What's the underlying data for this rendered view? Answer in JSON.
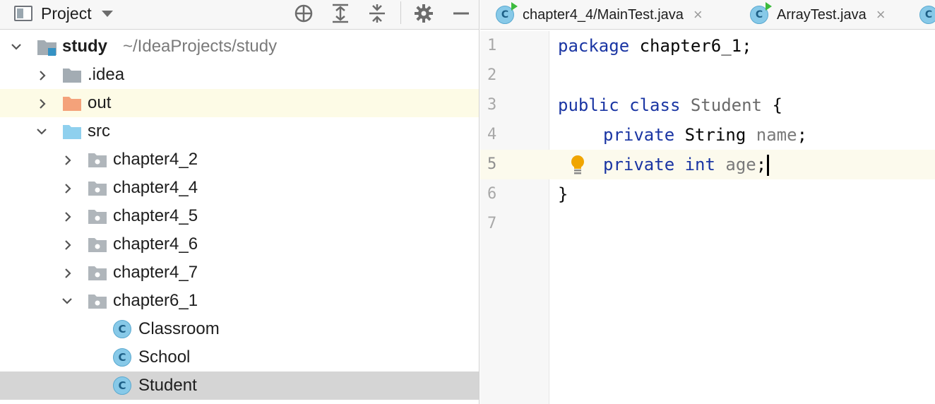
{
  "project_panel": {
    "title": "Project",
    "icons": [
      "locate-icon",
      "expand-all-icon",
      "collapse-all-icon",
      "gear-icon",
      "hide-icon"
    ],
    "tree": {
      "root": {
        "label": "study",
        "path_hint": "~/IdeaProjects/study"
      },
      "items": [
        {
          "label": ".idea"
        },
        {
          "label": "out"
        },
        {
          "label": "src"
        },
        {
          "label": "chapter4_2"
        },
        {
          "label": "chapter4_4"
        },
        {
          "label": "chapter4_5"
        },
        {
          "label": "chapter4_6"
        },
        {
          "label": "chapter4_7"
        },
        {
          "label": "chapter6_1"
        },
        {
          "label": "Classroom"
        },
        {
          "label": "School"
        },
        {
          "label": "Student"
        }
      ]
    }
  },
  "editor": {
    "tabs": [
      {
        "label": "chapter4_4/MainTest.java",
        "icon_letter": "C",
        "close": "×"
      },
      {
        "label": "ArrayTest.java",
        "icon_letter": "C",
        "close": "×"
      }
    ],
    "line_numbers": [
      "1",
      "2",
      "3",
      "4",
      "5",
      "6",
      "7"
    ],
    "current_line": 5,
    "code": {
      "l1_kw": "package",
      "l1_rest": " chapter6_1;",
      "l3_kw1": "public",
      "l3_kw2": " class",
      "l3_name": " Student",
      "l3_rest": " {",
      "l4_kw": "private",
      "l4_type": " String",
      "l4_name": " name",
      "l4_rest": ";",
      "l5_kw": "private",
      "l5_type": " int",
      "l5_name": " age",
      "l5_rest": ";",
      "l6": "}"
    }
  },
  "colors": {
    "keyword": "#1a35a3",
    "field": "#7a7a7a",
    "highlight_row": "#fdfbe6",
    "selected_row": "#d5d5d5",
    "class_icon": "#87c9e8",
    "folder_excluded": "#f4a27a",
    "folder_source": "#8fd0ee",
    "folder_package": "#b0b6bb"
  }
}
